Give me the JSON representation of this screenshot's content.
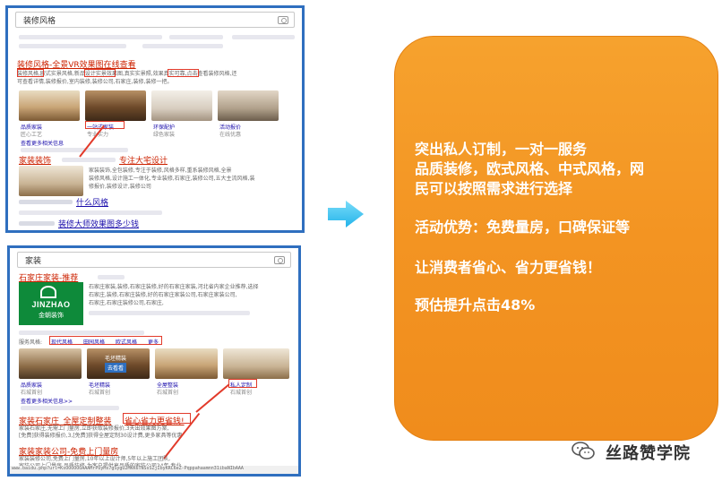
{
  "screenshot_top": {
    "search_query": "装修风格",
    "result1": {
      "title": "装修风格-全景VR效果图在线查看",
      "snippet_line1": "装修风格,欧式实景风格,新品设计实景效果图,真实实景照,效果真实可靠,点击查看装修风格,还",
      "snippet_line2": "可查看详情,装修报价,室内装修,装修公司,石家庄,装修,装修一把。",
      "thumbs": [
        {
          "cap": "品质家装",
          "sub": "匠心工艺"
        },
        {
          "cap": "一站式家装",
          "sub": "专业实力"
        },
        {
          "cap": "环保配护",
          "sub": "绿色家装"
        },
        {
          "cap": "活动报价",
          "sub": "在线优惠"
        }
      ],
      "more": "查看更多相关信息"
    },
    "result2": {
      "title": "家装装饰",
      "title_tail": "专注大宅设计",
      "snippet_line1": "家装装饰,全包装修,专注于装修,风格多样,重系装修风格,全景",
      "snippet_line2": "装修风格,设计施工一体化,专业装修,石家庄,装修公司,五大主流风格,装",
      "snippet_line3": "修报价,装修设计,装修公司"
    },
    "result3_tail": "什么风格",
    "result4_tail": "装修大师效果图多少钱"
  },
  "screenshot_bottom": {
    "search_query": "家装",
    "result1": {
      "title": "石家庄家装-推荐",
      "logo_text": "JINZHAO",
      "logo_sub": "金朝装饰",
      "snippet_line1": "石家庄家装,装修,石家庄装修,好的石家庄家装,河北省内家企业推荐,选择",
      "snippet_line2": "石家庄,装修,石家庄装修,好的石家庄家装公司,石家庄家装公司,",
      "snippet_line3": "石家庄,石家庄装修公司,石家庄,",
      "styles_label": "服务风格:",
      "styles": [
        "现代风格",
        "田园风格",
        "欧式风格",
        "更多"
      ],
      "thumbs": [
        {
          "cap": "品质家装",
          "sub": "石城首创"
        },
        {
          "cap": "毛坯精装",
          "sub": "石城首创"
        },
        {
          "cap": "全屋整装",
          "sub": "石城首创"
        },
        {
          "cap": "私人定制",
          "sub": "石城首创"
        }
      ],
      "overlay_label": "毛坯精装",
      "overlay_btn": "去看看",
      "more": "查看更多相关信息>>"
    },
    "result2": {
      "title_a": "家装石家庄_全屋定制整装",
      "title_b": "省心省力更省钱!",
      "snippet_line1": "家装石家庄,无需上门量房,立即获取装修报价,3天出效果图方案,",
      "snippet_line2": "[免费]获得装修报价,3,[免费]获得全屋定制30设计费,更多家具等优惠"
    },
    "result3": {
      "title": "家装家装公司-免费上门量房",
      "snippet_line1": "家装装修公司,免费上门量房,10年以上设计师,5年以上施工团队,",
      "snippet_line2": "家装公司上门量房,品质装修,为客户提供高品质的家装公司24年,专业"
    },
    "status_url": "www.baidu.php?url=KsOOOOOOAAAMrPUyMs7gSygU2MKK6TNSsSZjIbyKRC6eZ-Pqppahaamnn31ibaNIbAAA"
  },
  "card": {
    "line1": "突出私人订制，一对一服务",
    "line2": "品质装修，欧式风格、中式风格，网",
    "line3": "民可以按照需求进行选择",
    "line4": "活动优势：免费量房，口碑保证等",
    "line5": "让消费者省心、省力更省钱！",
    "line6": "预估提升点击48%"
  },
  "watermark": {
    "text": "丝路赞学院",
    "icon": "wechat-icon"
  },
  "colors": {
    "card_orange": "#f39422",
    "screenshot_border": "#2f6fbf",
    "arrow_cyan": "#36c4f2",
    "highlight_red": "#e23a2a",
    "link_blue": "#1a0dab"
  }
}
